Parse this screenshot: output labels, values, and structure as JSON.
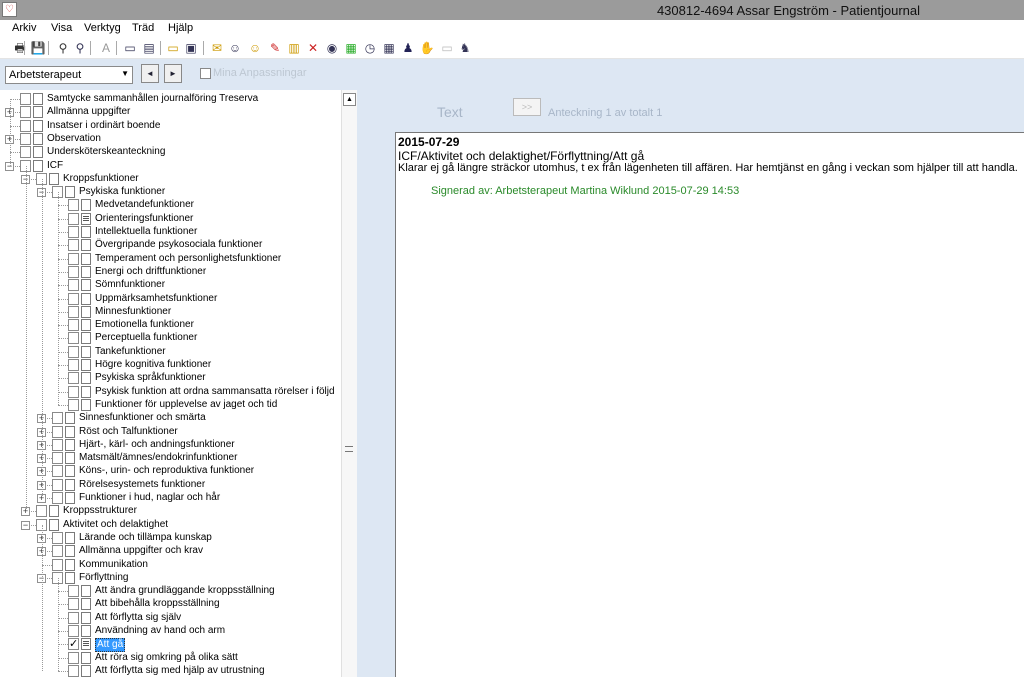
{
  "window": {
    "title": "430812-4694 Assar Engström - Patientjournal",
    "app_icon": "heart-app-icon"
  },
  "menu": [
    "Arkiv",
    "Visa",
    "Verktyg",
    "Träd",
    "Hjälp"
  ],
  "toolbar": {
    "icons": [
      "print-icon",
      "save-icon",
      "binoculars-icon",
      "binoculars-search-icon",
      "font-icon",
      "window-icon",
      "window-list-icon",
      "folder-open-icon",
      "camera-icon",
      "envelope-icon",
      "people-icon",
      "users-group-icon",
      "pen-icon",
      "certificate-icon",
      "chart-line-icon",
      "eye-icon",
      "spreadsheet-icon",
      "clock-icon",
      "table-icon",
      "people-link-icon",
      "handshake-icon",
      "disabled-icon",
      "person-tree-icon"
    ]
  },
  "filter": {
    "role": "Arbetsterapeut",
    "prev_label": "◄",
    "next_label": "►",
    "mina_label": "Mina Anpassningar",
    "mina_checked": false
  },
  "tree": {
    "nodes": [
      {
        "label": "Samtycke sammanhållen journalföring Treserva",
        "level": 0,
        "exp": "",
        "doc": true,
        "filled": false
      },
      {
        "label": "Allmänna uppgifter",
        "level": 0,
        "exp": "+",
        "doc": true,
        "filled": false
      },
      {
        "label": "Insatser i ordinärt boende",
        "level": 0,
        "exp": "",
        "doc": true,
        "filled": false
      },
      {
        "label": "Observation",
        "level": 0,
        "exp": "+",
        "doc": true,
        "filled": false
      },
      {
        "label": "Undersköterskeanteckning",
        "level": 0,
        "exp": "",
        "doc": true,
        "filled": false
      },
      {
        "label": "ICF",
        "level": 0,
        "exp": "-",
        "doc": true,
        "filled": false
      },
      {
        "label": "Kroppsfunktioner",
        "level": 1,
        "exp": "-",
        "doc": true,
        "filled": false
      },
      {
        "label": "Psykiska funktioner",
        "level": 2,
        "exp": "-",
        "doc": true,
        "filled": false
      },
      {
        "label": "Medvetandefunktioner",
        "level": 3,
        "exp": "",
        "doc": true,
        "filled": false
      },
      {
        "label": "Orienteringsfunktioner",
        "level": 3,
        "exp": "",
        "doc": true,
        "filled": true
      },
      {
        "label": "Intellektuella funktioner",
        "level": 3,
        "exp": "",
        "doc": true,
        "filled": false
      },
      {
        "label": "Övergripande psykosociala funktioner",
        "level": 3,
        "exp": "",
        "doc": true,
        "filled": false
      },
      {
        "label": "Temperament och personlighetsfunktioner",
        "level": 3,
        "exp": "",
        "doc": true,
        "filled": false
      },
      {
        "label": "Energi och driftfunktioner",
        "level": 3,
        "exp": "",
        "doc": true,
        "filled": false
      },
      {
        "label": "Sömnfunktioner",
        "level": 3,
        "exp": "",
        "doc": true,
        "filled": false
      },
      {
        "label": "Uppmärksamhetsfunktioner",
        "level": 3,
        "exp": "",
        "doc": true,
        "filled": false
      },
      {
        "label": "Minnesfunktioner",
        "level": 3,
        "exp": "",
        "doc": true,
        "filled": false
      },
      {
        "label": "Emotionella funktioner",
        "level": 3,
        "exp": "",
        "doc": true,
        "filled": false
      },
      {
        "label": "Perceptuella funktioner",
        "level": 3,
        "exp": "",
        "doc": true,
        "filled": false
      },
      {
        "label": "Tankefunktioner",
        "level": 3,
        "exp": "",
        "doc": true,
        "filled": false
      },
      {
        "label": "Högre kognitiva funktioner",
        "level": 3,
        "exp": "",
        "doc": true,
        "filled": false
      },
      {
        "label": "Psykiska språkfunktioner",
        "level": 3,
        "exp": "",
        "doc": true,
        "filled": false
      },
      {
        "label": "Psykisk funktion att ordna sammansatta rörelser i följd",
        "level": 3,
        "exp": "",
        "doc": true,
        "filled": false
      },
      {
        "label": "Funktioner för upplevelse av jaget och tid",
        "level": 3,
        "exp": "",
        "doc": true,
        "filled": false
      },
      {
        "label": "Sinnesfunktioner och smärta",
        "level": 2,
        "exp": "+",
        "doc": true,
        "filled": false
      },
      {
        "label": "Röst och Talfunktioner",
        "level": 2,
        "exp": "+",
        "doc": true,
        "filled": false
      },
      {
        "label": "Hjärt-, kärl- och andningsfunktioner",
        "level": 2,
        "exp": "+",
        "doc": true,
        "filled": false
      },
      {
        "label": "Matsmält/ämnes/endokrinfunktioner",
        "level": 2,
        "exp": "+",
        "doc": true,
        "filled": false
      },
      {
        "label": "Köns-, urin- och reproduktiva funktioner",
        "level": 2,
        "exp": "+",
        "doc": true,
        "filled": false
      },
      {
        "label": "Rörelsesystemets funktioner",
        "level": 2,
        "exp": "+",
        "doc": true,
        "filled": false
      },
      {
        "label": "Funktioner i hud, naglar och hår",
        "level": 2,
        "exp": "+",
        "doc": true,
        "filled": false
      },
      {
        "label": "Kroppsstrukturer",
        "level": 1,
        "exp": "+",
        "doc": true,
        "filled": false
      },
      {
        "label": "Aktivitet och delaktighet",
        "level": 1,
        "exp": "-",
        "doc": true,
        "filled": false
      },
      {
        "label": "Lärande och tillämpa kunskap",
        "level": 2,
        "exp": "+",
        "doc": true,
        "filled": false
      },
      {
        "label": "Allmänna uppgifter och krav",
        "level": 2,
        "exp": "+",
        "doc": true,
        "filled": false
      },
      {
        "label": "Kommunikation",
        "level": 2,
        "exp": "",
        "doc": true,
        "filled": false
      },
      {
        "label": "Förflyttning",
        "level": 2,
        "exp": "-",
        "doc": true,
        "filled": false
      },
      {
        "label": "Att ändra grundläggande kroppsställning",
        "level": 3,
        "exp": "",
        "doc": true,
        "filled": false
      },
      {
        "label": "Att bibehålla kroppsställning",
        "level": 3,
        "exp": "",
        "doc": true,
        "filled": false
      },
      {
        "label": "Att förflytta sig själv",
        "level": 3,
        "exp": "",
        "doc": true,
        "filled": false
      },
      {
        "label": "Användning av hand och arm",
        "level": 3,
        "exp": "",
        "doc": true,
        "filled": false
      },
      {
        "label": "Att gå",
        "level": 3,
        "exp": "",
        "doc": true,
        "filled": true,
        "checked": true,
        "selected": true
      },
      {
        "label": "Att röra sig omkring på olika sätt",
        "level": 3,
        "exp": "",
        "doc": true,
        "filled": false
      },
      {
        "label": "Att förflytta sig med hjälp av utrustning",
        "level": 3,
        "exp": "",
        "doc": true,
        "filled": false
      }
    ]
  },
  "note": {
    "tab_label": "Text",
    "next_label": ">>",
    "count": "Anteckning 1 av totalt 1",
    "date": "2015-07-29",
    "path": "ICF/Aktivitet och delaktighet/Förflyttning/Att gå",
    "text": "Klarar ej gå längre sträckor utomhus, t ex från lägenheten till affären. Har hemtjänst en gång i veckan som hjälper till att handla.",
    "signed": "Signerad av: Arbetsterapeut Martina Wiklund 2015-07-29 14:53"
  },
  "colors": {
    "titlebar": "#9b9b9b",
    "panel_bg": "#dde7f3",
    "selection": "#3399ff",
    "signature": "#2a8a2a"
  }
}
